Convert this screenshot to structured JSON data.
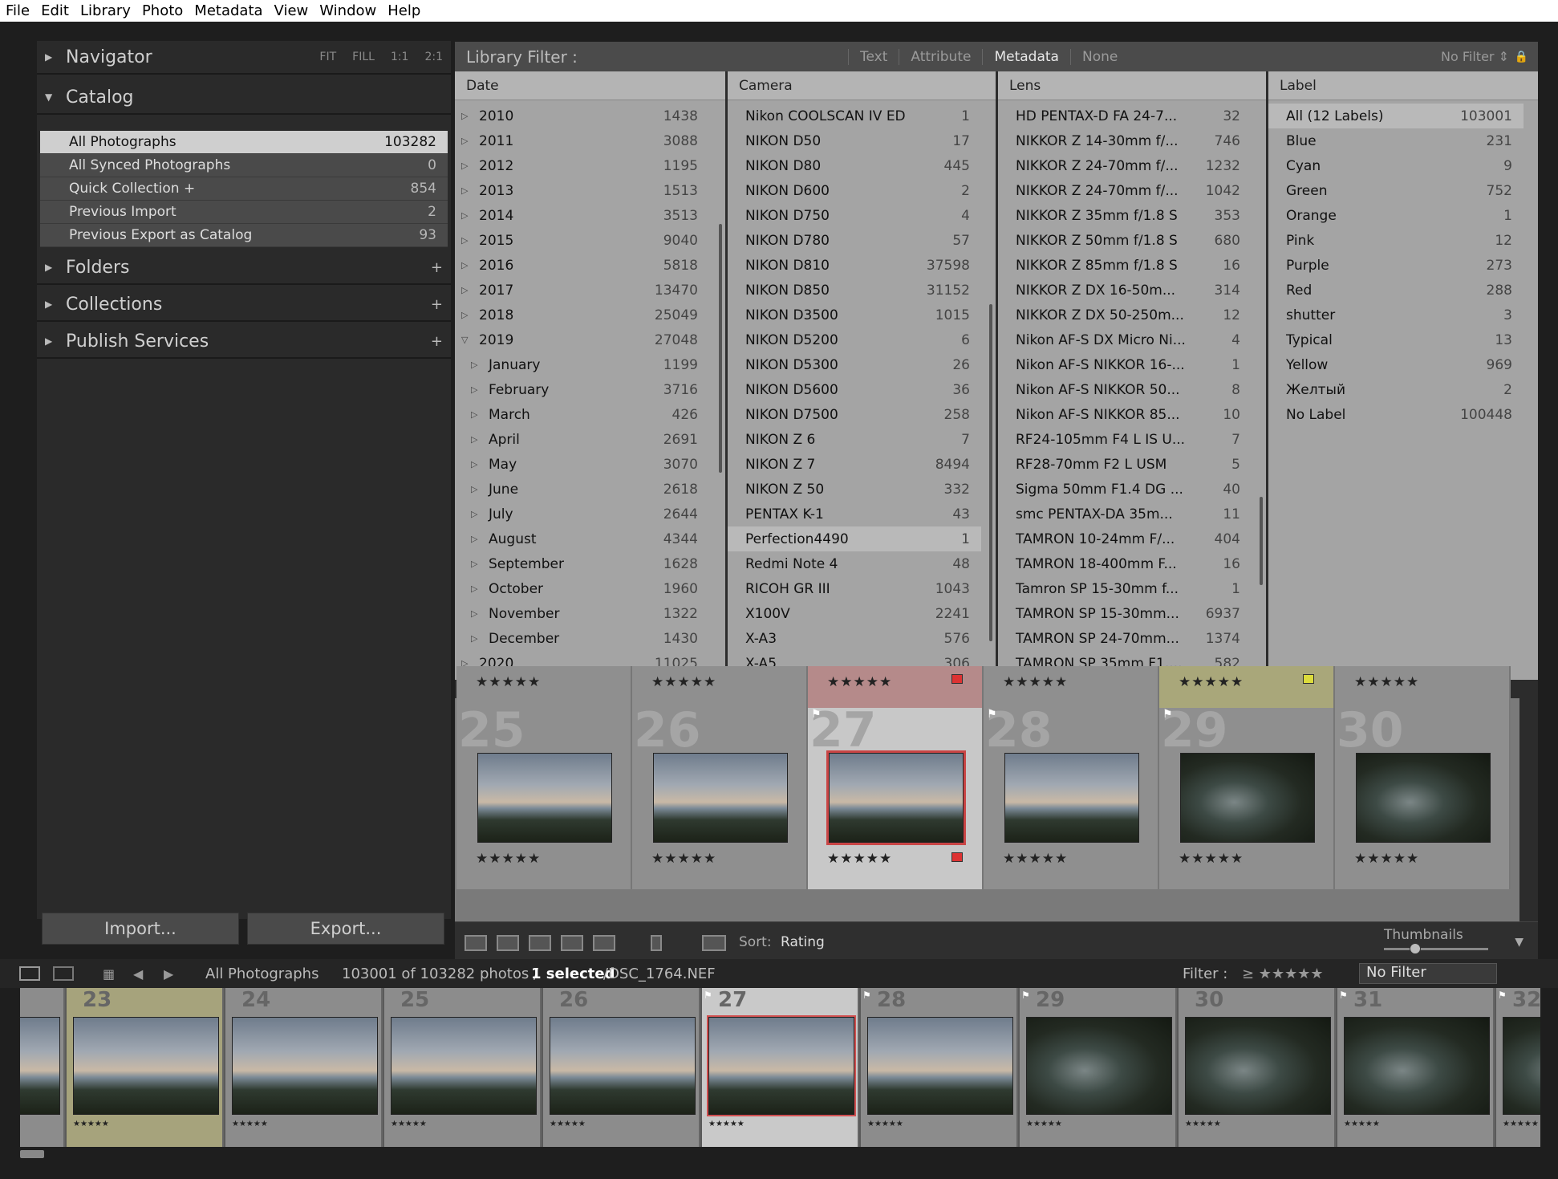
{
  "menu": [
    "File",
    "Edit",
    "Library",
    "Photo",
    "Metadata",
    "View",
    "Window",
    "Help"
  ],
  "left": {
    "navigator": {
      "title": "Navigator",
      "buttons": [
        "FIT",
        "FILL",
        "1:1",
        "2:1"
      ]
    },
    "catalog": {
      "title": "Catalog",
      "items": [
        {
          "label": "All Photographs",
          "count": "103282"
        },
        {
          "label": "All Synced Photographs",
          "count": "0"
        },
        {
          "label": "Quick Collection  +",
          "count": "854"
        },
        {
          "label": "Previous Import",
          "count": "2"
        },
        {
          "label": "Previous Export as Catalog",
          "count": "93"
        }
      ]
    },
    "folders": "Folders",
    "collections": "Collections",
    "publish": "Publish Services",
    "import": "Import...",
    "export": "Export..."
  },
  "filter": {
    "title": "Library Filter :",
    "tabs": [
      "Text",
      "Attribute",
      "Metadata",
      "None"
    ],
    "active": "Metadata",
    "no_filter": "No Filter"
  },
  "columns": {
    "date": {
      "header": "Date",
      "rows": [
        [
          "2010",
          "1438",
          0
        ],
        [
          "2011",
          "3088",
          0
        ],
        [
          "2012",
          "1195",
          0
        ],
        [
          "2013",
          "1513",
          0
        ],
        [
          "2014",
          "3513",
          0
        ],
        [
          "2015",
          "9040",
          0
        ],
        [
          "2016",
          "5818",
          0
        ],
        [
          "2017",
          "13470",
          0
        ],
        [
          "2018",
          "25049",
          0
        ],
        [
          "2019",
          "27048",
          2
        ],
        [
          "January",
          "1199",
          1
        ],
        [
          "February",
          "3716",
          1
        ],
        [
          "March",
          "426",
          1
        ],
        [
          "April",
          "2691",
          1
        ],
        [
          "May",
          "3070",
          1
        ],
        [
          "June",
          "2618",
          1
        ],
        [
          "July",
          "2644",
          1
        ],
        [
          "August",
          "4344",
          1
        ],
        [
          "September",
          "1628",
          1
        ],
        [
          "October",
          "1960",
          1
        ],
        [
          "November",
          "1322",
          1
        ],
        [
          "December",
          "1430",
          1
        ],
        [
          "2020",
          "11025",
          0
        ]
      ]
    },
    "camera": {
      "header": "Camera",
      "rows": [
        [
          "Nikon COOLSCAN IV ED",
          "1"
        ],
        [
          "NIKON D50",
          "17"
        ],
        [
          "NIKON D80",
          "445"
        ],
        [
          "NIKON D600",
          "2"
        ],
        [
          "NIKON D750",
          "4"
        ],
        [
          "NIKON D780",
          "57"
        ],
        [
          "NIKON D810",
          "37598"
        ],
        [
          "NIKON D850",
          "31152"
        ],
        [
          "NIKON D3500",
          "1015"
        ],
        [
          "NIKON D5200",
          "6"
        ],
        [
          "NIKON D5300",
          "26"
        ],
        [
          "NIKON D5600",
          "36"
        ],
        [
          "NIKON D7500",
          "258"
        ],
        [
          "NIKON Z 6",
          "7"
        ],
        [
          "NIKON Z 7",
          "8494"
        ],
        [
          "NIKON Z 50",
          "332"
        ],
        [
          "PENTAX K-1",
          "43"
        ],
        [
          "Perfection4490",
          "1"
        ],
        [
          "Redmi Note 4",
          "48"
        ],
        [
          "RICOH GR III",
          "1043"
        ],
        [
          "X100V",
          "2241"
        ],
        [
          "X-A3",
          "576"
        ],
        [
          "X-A5",
          "306"
        ]
      ]
    },
    "lens": {
      "header": "Lens",
      "rows": [
        [
          "HD PENTAX-D FA 24-7...",
          "32"
        ],
        [
          "NIKKOR Z 14-30mm f/...",
          "746"
        ],
        [
          "NIKKOR Z 24-70mm f/...",
          "1232"
        ],
        [
          "NIKKOR Z 24-70mm f/...",
          "1042"
        ],
        [
          "NIKKOR Z 35mm f/1.8 S",
          "353"
        ],
        [
          "NIKKOR Z 50mm f/1.8 S",
          "680"
        ],
        [
          "NIKKOR Z 85mm f/1.8 S",
          "16"
        ],
        [
          "NIKKOR Z DX 16-50m...",
          "314"
        ],
        [
          "NIKKOR Z DX 50-250m...",
          "12"
        ],
        [
          "Nikon AF-S DX Micro Ni...",
          "4"
        ],
        [
          "Nikon AF-S NIKKOR 16-...",
          "1"
        ],
        [
          "Nikon AF-S NIKKOR 50...",
          "8"
        ],
        [
          "Nikon AF-S NIKKOR 85...",
          "10"
        ],
        [
          "RF24-105mm F4 L IS U...",
          "7"
        ],
        [
          "RF28-70mm F2 L USM",
          "5"
        ],
        [
          "Sigma 50mm F1.4 DG ...",
          "40"
        ],
        [
          "smc PENTAX-DA 35m...",
          "11"
        ],
        [
          "TAMRON 10-24mm F/...",
          "404"
        ],
        [
          "TAMRON 18-400mm F...",
          "16"
        ],
        [
          "Tamron SP 15-30mm f...",
          "1"
        ],
        [
          "TAMRON SP 15-30mm...",
          "6937"
        ],
        [
          "TAMRON SP 24-70mm...",
          "1374"
        ],
        [
          "TAMRON SP 35mm F1....",
          "582"
        ]
      ]
    },
    "label": {
      "header": "Label",
      "rows": [
        [
          "All (12 Labels)",
          "103001"
        ],
        [
          "Blue",
          "231"
        ],
        [
          "Cyan",
          "9"
        ],
        [
          "Green",
          "752"
        ],
        [
          "Orange",
          "1"
        ],
        [
          "Pink",
          "12"
        ],
        [
          "Purple",
          "273"
        ],
        [
          "Red",
          "288"
        ],
        [
          "shutter",
          "3"
        ],
        [
          "Typical",
          "13"
        ],
        [
          "Yellow",
          "969"
        ],
        [
          "Желтый",
          "2"
        ],
        [
          "No Label",
          "100448"
        ]
      ]
    }
  },
  "grid": {
    "cells": [
      {
        "num": "25",
        "style": "",
        "top": "",
        "flag": false
      },
      {
        "num": "26",
        "style": "",
        "top": "",
        "flag": false
      },
      {
        "num": "27",
        "style": "sel",
        "top": "red",
        "flag": true
      },
      {
        "num": "28",
        "style": "",
        "top": "",
        "flag": true
      },
      {
        "num": "29",
        "style": "",
        "top": "yel",
        "flag": true
      },
      {
        "num": "30",
        "style": "",
        "top": "",
        "flag": false
      }
    ],
    "stars": "★★★★★"
  },
  "toolbar": {
    "sort_label": "Sort:",
    "sort_value": "Rating",
    "thumbnails": "Thumbnails"
  },
  "filmbar": {
    "source": "All Photographs",
    "count": "103001 of 103282 photos /",
    "selected": "1 selected",
    "file": "/DSC_1764.NEF",
    "filter_label": "Filter :",
    "filter_value": "No Filter",
    "stars": "≥ ★★★★★"
  },
  "filmstrip": [
    "23",
    "24",
    "25",
    "26",
    "27",
    "28",
    "29",
    "30",
    "31",
    "32"
  ],
  "colors": {
    "selected_border": "#c94545",
    "yellow_label": "#dcdc3c",
    "red_label": "#d33"
  }
}
